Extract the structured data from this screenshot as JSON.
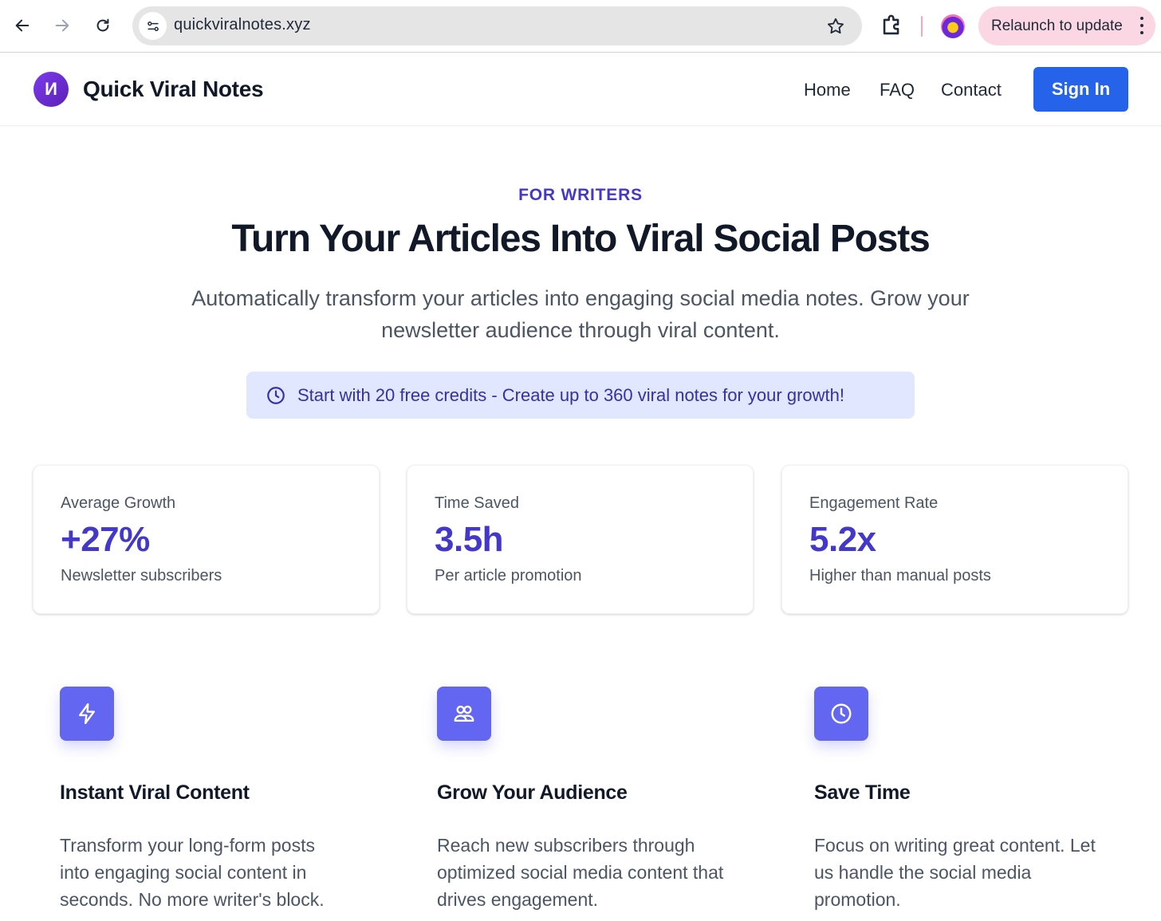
{
  "browser": {
    "url": "quickviralnotes.xyz",
    "relaunch_label": "Relaunch to update"
  },
  "header": {
    "brand": "Quick Viral Notes",
    "logo_letter": "И",
    "nav": [
      "Home",
      "FAQ",
      "Contact"
    ],
    "signin_label": "Sign In"
  },
  "hero": {
    "eyebrow": "FOR WRITERS",
    "title": "Turn Your Articles Into Viral Social Posts",
    "subtitle": "Automatically transform your articles into engaging social media notes. Grow your newsletter audience through viral content.",
    "credits_banner": "Start with 20 free credits - Create up to 360 viral notes for your growth!"
  },
  "stats": [
    {
      "label": "Average Growth",
      "value": "+27%",
      "note": "Newsletter subscribers"
    },
    {
      "label": "Time Saved",
      "value": "3.5h",
      "note": "Per article promotion"
    },
    {
      "label": "Engagement Rate",
      "value": "5.2x",
      "note": "Higher than manual posts"
    }
  ],
  "features": [
    {
      "icon": "lightning-icon",
      "title": "Instant Viral Content",
      "desc": "Transform your long-form posts into engaging social content in seconds. No more writer's block."
    },
    {
      "icon": "users-icon",
      "title": "Grow Your Audience",
      "desc": "Reach new subscribers through optimized social media content that drives engagement."
    },
    {
      "icon": "clock-icon",
      "title": "Save Time",
      "desc": "Focus on writing great content. Let us handle the social media promotion."
    }
  ],
  "colors": {
    "accent": "#4338ca",
    "signin_blue": "#2563eb",
    "feature_icon_bg": "#6366f1",
    "banner_bg": "#e0e7ff",
    "relaunch_bg": "#fbd7e4"
  }
}
